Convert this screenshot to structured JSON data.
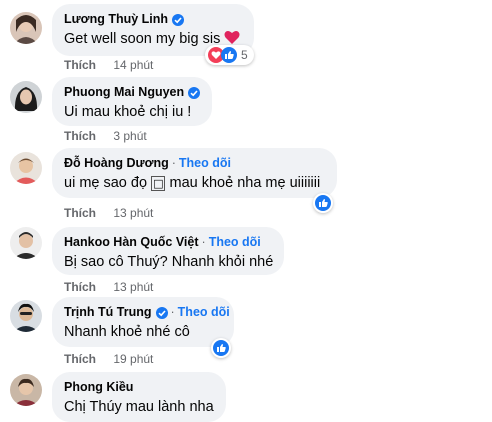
{
  "comments": [
    {
      "name": "Lương Thuỳ Linh",
      "verified": true,
      "text": "Get well soon my big sis",
      "emoji": "heart",
      "like": "Thích",
      "time": "14 phút",
      "reaction_count": "5"
    },
    {
      "name": "Phuong Mai Nguyen",
      "verified": true,
      "text": "Ui mau khoẻ chị iu !",
      "like": "Thích",
      "time": "3 phút"
    },
    {
      "name": "Đỗ Hoàng Dương",
      "follow": "Theo dõi",
      "text_before": "ui mẹ sao đọ",
      "missing_glyph": "□",
      "text_after": "mau khoẻ nha mẹ uiiiiiii",
      "like": "Thích",
      "time": "13 phút"
    },
    {
      "name": "Hankoo Hàn Quốc Việt",
      "follow": "Theo dõi",
      "text": "Bị sao cô Thuý? Nhanh khỏi nhé",
      "like": "Thích",
      "time": "13 phút"
    },
    {
      "name": "Trịnh Tú Trung",
      "verified": true,
      "follow": "Theo dõi",
      "text": "Nhanh khoẻ nhé cô",
      "like": "Thích",
      "time": "19 phút"
    },
    {
      "name": "Phong Kiều",
      "text": "Chị Thúy mau lành nha"
    }
  ],
  "separator": "·",
  "colors": {
    "bubble": "#f0f2f5",
    "accent": "#1877f2",
    "meta": "#65676b",
    "heart": "#f33e58"
  }
}
